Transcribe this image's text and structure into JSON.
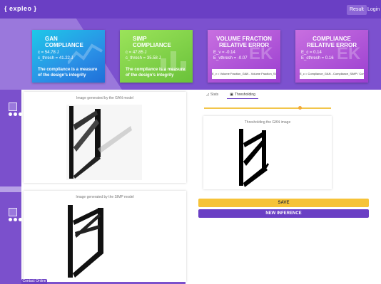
{
  "app": {
    "logo": "{ expleo }"
  },
  "nav": {
    "result_label": "Result",
    "login_label": "Login"
  },
  "cards": {
    "gan": {
      "title_line1": "GAN",
      "title_line2": "COMPLIANCE",
      "line1": "c = 54.78 J",
      "line2": "c_thresh = 41.22 J",
      "desc": "The compliance is a measure of the design's integrity"
    },
    "simp": {
      "title_line1": "SIMP",
      "title_line2": "COMPLIANCE",
      "line1": "c = 47.85 J",
      "line2": "c_thresh = 35.58 J",
      "desc": "The compliance is a measure of the design's integrity"
    },
    "vfre": {
      "title_line1": "VOLUME FRACTION",
      "title_line2": "RELATIVE ERROR",
      "line1": "E_v = -0.14",
      "line2": "E_vthresh = -0.07",
      "formula": "E_v = Volume Fraction_GAN - Volume Fraction_SIMP / Volume Fraction_SIMP"
    },
    "cre": {
      "title_line1": "COMPLIANCE",
      "title_line2": "RELATIVE ERROR",
      "line1": "E_c = 0.14",
      "line2": "E_cthresh = 0.16",
      "formula": "E_c = Compliance_GAN - Compliance_SIMP / Compliance_SIMP"
    }
  },
  "panels": {
    "gan_image": {
      "caption": "Image generated by the GAN model"
    },
    "simp_image": {
      "caption": "Image generated by the SIMP model"
    },
    "threshold_image": {
      "caption": "Thresholding the GAN image"
    }
  },
  "tabs": [
    {
      "label": "Stats",
      "icon": "chart-icon"
    },
    {
      "label": "Thresholding",
      "icon": "image-icon"
    }
  ],
  "slider": {
    "value_fraction": 0.75
  },
  "actions": {
    "save_label": "SAVE",
    "new_inference_label": "NEW INFERENCE"
  },
  "footer": {
    "label": "Contact Online"
  },
  "colors": {
    "primary": "#6a3fc4",
    "accent": "#f6c338",
    "gan": "#2a90e6",
    "simp": "#6ac23a",
    "error": "#9b3fd0"
  }
}
